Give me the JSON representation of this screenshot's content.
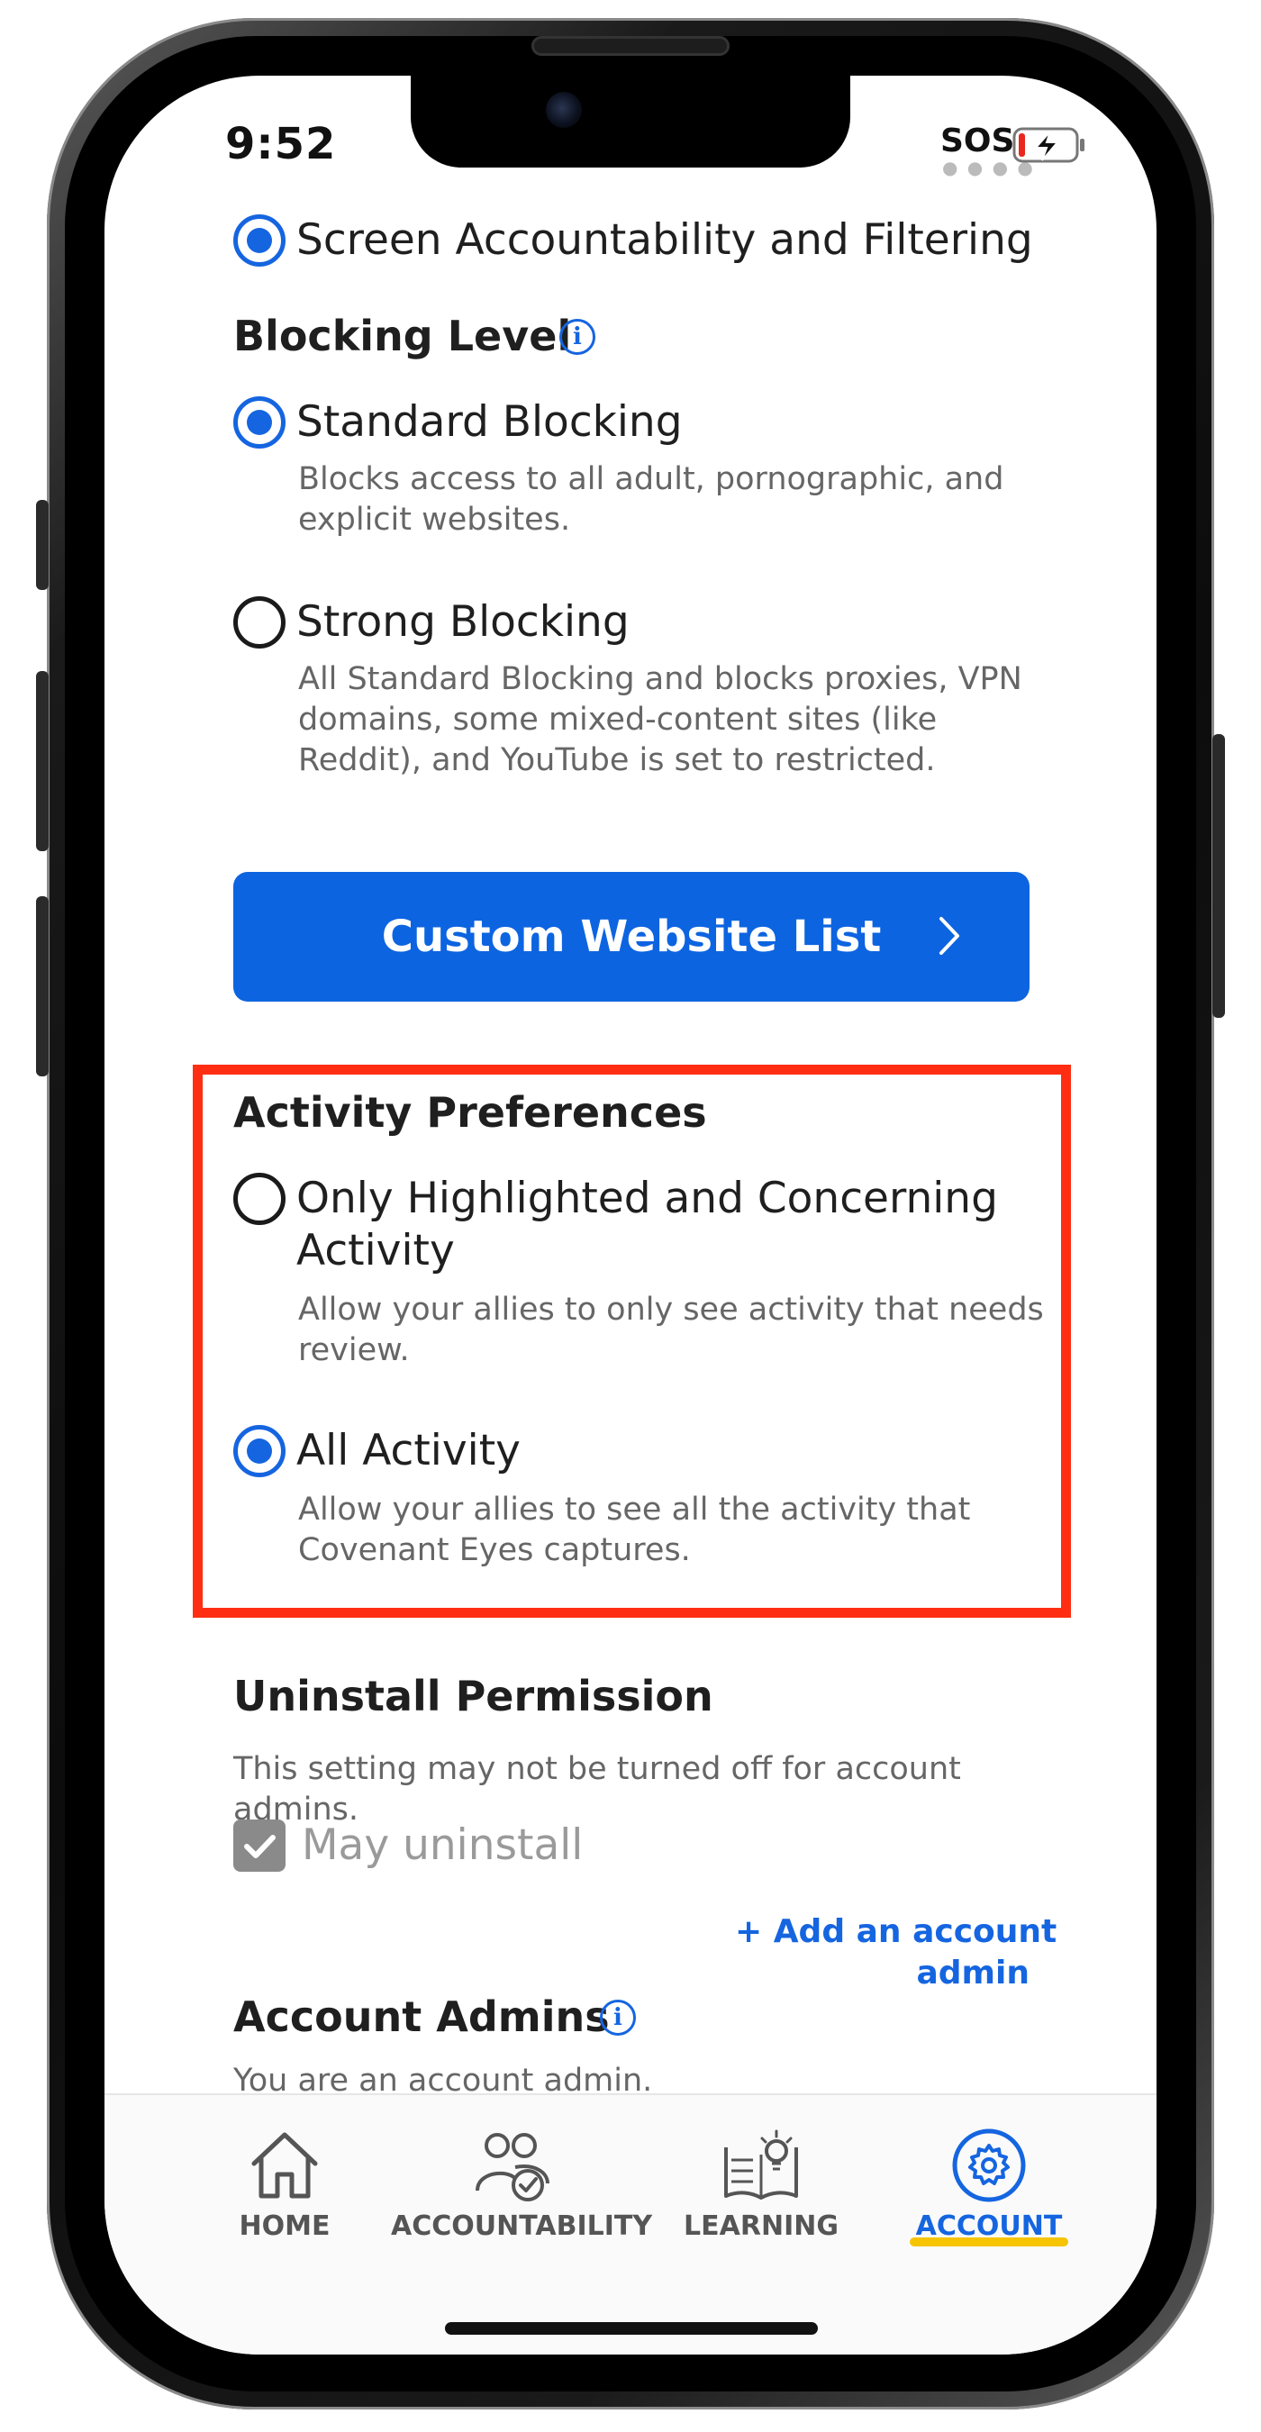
{
  "status_bar": {
    "time": "9:52",
    "sos_label": "SOS",
    "battery_icon": "battery-charging-icon"
  },
  "filtering": {
    "mode_label": "Screen Accountability and Filtering",
    "mode_selected": true
  },
  "blocking_level": {
    "title": "Blocking Level",
    "info_icon": "info-icon",
    "options": [
      {
        "label": "Standard Blocking",
        "selected": true,
        "description_lines": [
          "Blocks access to all adult, pornographic, and",
          "explicit websites."
        ]
      },
      {
        "label": "Strong Blocking",
        "selected": false,
        "description_lines": [
          "All Standard Blocking and blocks proxies, VPN",
          "domains, some mixed-content sites (like",
          "Reddit), and YouTube is set to restricted."
        ]
      }
    ]
  },
  "custom_website_list": {
    "label": "Custom Website List",
    "icon": "chevron-right-icon"
  },
  "activity_preferences": {
    "title": "Activity Preferences",
    "options": [
      {
        "label_lines": [
          "Only Highlighted and Concerning",
          "Activity"
        ],
        "selected": false,
        "description_lines": [
          "Allow your allies to only see activity that needs",
          "review."
        ]
      },
      {
        "label_lines": [
          "All Activity"
        ],
        "selected": true,
        "description_lines": [
          "Allow your allies to see all the activity that",
          "Covenant Eyes captures."
        ]
      }
    ]
  },
  "uninstall_permission": {
    "title": "Uninstall Permission",
    "description_lines": [
      "This setting may not be turned off for account",
      "admins."
    ],
    "checkbox_label": "May uninstall",
    "checked": true,
    "disabled": true
  },
  "account_admins": {
    "title": "Account Admins",
    "info_icon": "info-icon",
    "add_link_lines": [
      "+ Add an account",
      "admin"
    ],
    "subtitle": "You are an account admin."
  },
  "tab_bar": {
    "tabs": [
      {
        "label": "HOME",
        "icon": "home-icon",
        "active": false
      },
      {
        "label": "ACCOUNTABILITY",
        "icon": "accountability-icon",
        "active": false
      },
      {
        "label": "LEARNING",
        "icon": "learning-icon",
        "active": false
      },
      {
        "label": "ACCOUNT",
        "icon": "gear-icon",
        "active": true
      }
    ]
  },
  "colors": {
    "accent_blue": "#1565e0",
    "button_blue": "#0d64e0",
    "highlight_red": "#ff2e12",
    "active_tab_underline": "#f6c400"
  }
}
